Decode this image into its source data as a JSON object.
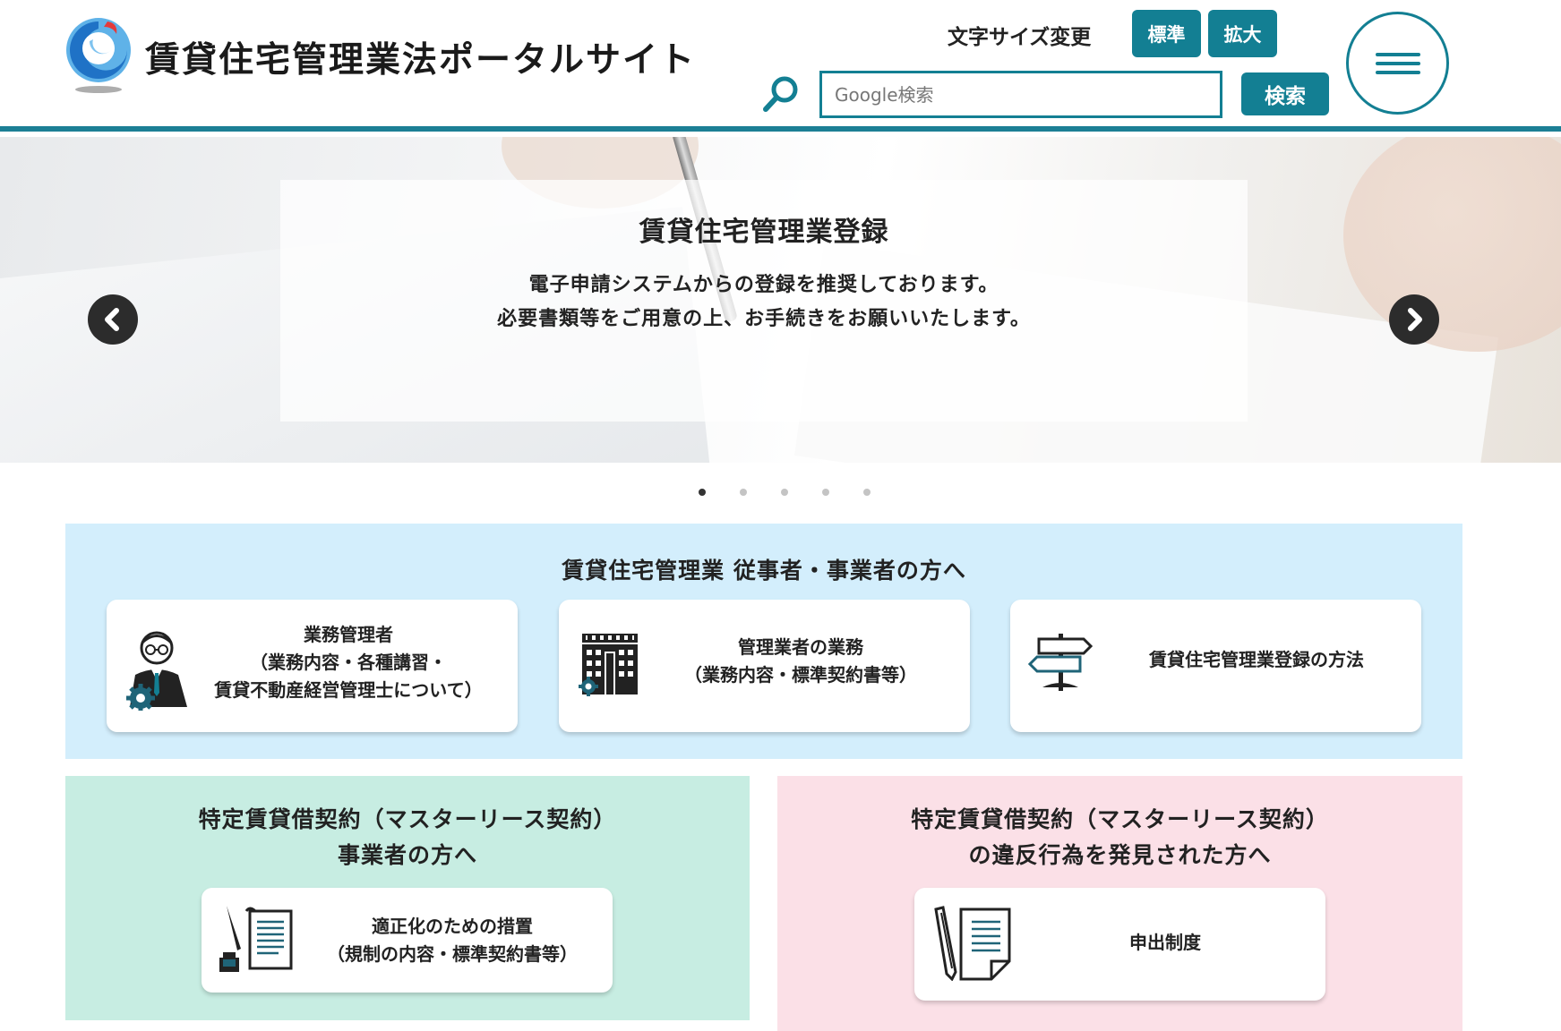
{
  "header": {
    "site_title": "賃貸住宅管理業法ポータルサイト",
    "font_size_label": "文字サイズ変更",
    "font_std_label": "標準",
    "font_large_label": "拡大",
    "search_placeholder": "Google検索",
    "search_button_label": "検索",
    "logo_icon": "mlit-logo-icon",
    "menu_icon": "hamburger-menu-icon"
  },
  "hero": {
    "title": "賃貸住宅管理業登録",
    "text_line1": "電子申請システムからの登録を推奨しております。",
    "text_line2": "必要書類等をご用意の上、お手続きをお願いいたします。",
    "prev_icon": "chevron-left-icon",
    "next_icon": "chevron-right-icon",
    "slide_count": 5,
    "active_slide": 1
  },
  "section_business": {
    "title": "賃貸住宅管理業 従事者・事業者の方へ",
    "cards": [
      {
        "line1": "業務管理者",
        "line2": "（業務内容・各種講習・",
        "line3": "賃貸不動産経営管理士について）",
        "icon": "manager-person-gear-icon"
      },
      {
        "line1": "管理業者の業務",
        "line2": "（業務内容・標準契約書等）",
        "icon": "building-gear-icon"
      },
      {
        "line1": "賃貸住宅管理業登録の方法",
        "icon": "signpost-icon"
      }
    ]
  },
  "section_master_lease": {
    "title_line1": "特定賃貸借契約（マスターリース契約）",
    "title_line2": "事業者の方へ",
    "card": {
      "line1": "適正化のための措置",
      "line2": "（規制の内容・標準契約書等）",
      "icon": "pen-ink-document-icon"
    }
  },
  "section_report": {
    "title_line1": "特定賃貸借契約（マスターリース契約）",
    "title_line2": "の違反行為を発見された方へ",
    "card": {
      "line1": "申出制度",
      "icon": "pencil-document-icon"
    }
  },
  "colors": {
    "accent": "#137f93",
    "blue_section": "#d3eefc",
    "green_section": "#c7ede2",
    "pink_section": "#fbe0e7"
  }
}
